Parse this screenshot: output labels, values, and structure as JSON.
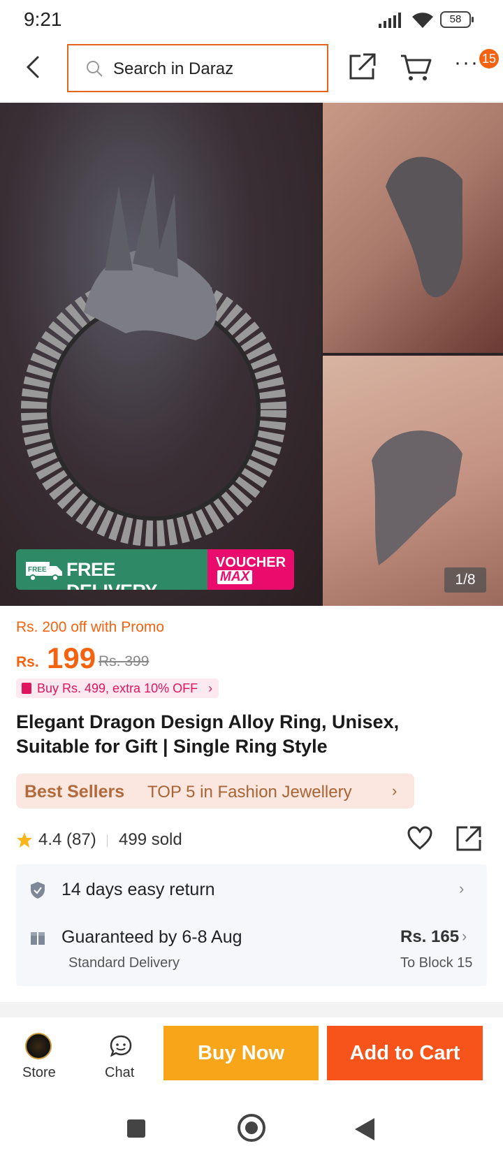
{
  "status_bar": {
    "time": "9:21",
    "battery": "58"
  },
  "header": {
    "search_placeholder": "Search in Daraz",
    "cart_badge": "15"
  },
  "gallery": {
    "delivery_label": "FREE DELIVERY",
    "truck_label": "FREE",
    "voucher_line1": "VOUCHER",
    "voucher_line2": "MAX",
    "counter": "1/8"
  },
  "pricing": {
    "promo": "Rs. 200 off with Promo",
    "currency": "Rs.",
    "price": "199",
    "original_price": "Rs. 399",
    "deal": "Buy Rs. 499, extra 10% OFF"
  },
  "product": {
    "title": "Elegant Dragon Design Alloy Ring, Unisex, Suitable for Gift | Single Ring Style"
  },
  "bestseller": {
    "label": "Best Sellers",
    "rank": "TOP 5 in Fashion Jewellery"
  },
  "rating": {
    "score": "4.4 (87)",
    "sold": "499 sold"
  },
  "services": {
    "return": "14 days easy return",
    "delivery": "Guaranteed by 6-8 Aug",
    "delivery_type": "Standard Delivery",
    "delivery_price": "Rs. 165",
    "location": "To Block 15"
  },
  "actions": {
    "store": "Store",
    "chat": "Chat",
    "buy_now": "Buy Now",
    "add_to_cart": "Add to Cart"
  },
  "colors": {
    "accent": "#f56311",
    "buy_now": "#f9a51a",
    "add_to_cart": "#f6541b",
    "free_delivery": "#2e8a66",
    "voucher": "#ea0c6c"
  }
}
